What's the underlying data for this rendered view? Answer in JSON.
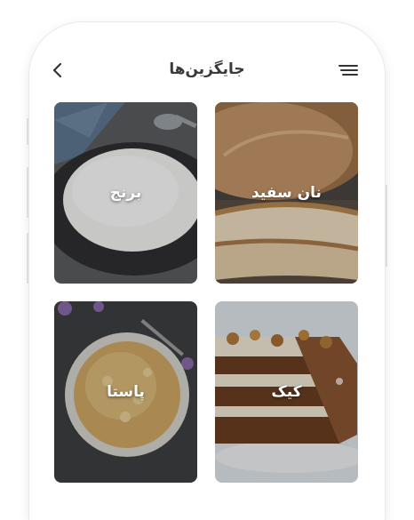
{
  "header": {
    "title": "جایگزین‌ها",
    "back_icon": "chevron-left-icon",
    "menu_icon": "hamburger-menu-icon"
  },
  "cards": [
    {
      "id": "bread",
      "label": "نان سفید"
    },
    {
      "id": "rice",
      "label": "برنج"
    },
    {
      "id": "cake",
      "label": "کیک"
    },
    {
      "id": "pasta",
      "label": "پاستا"
    }
  ],
  "colors": {
    "title": "#3a3a3a",
    "card_text": "#ffffff",
    "background": "#ffffff"
  }
}
